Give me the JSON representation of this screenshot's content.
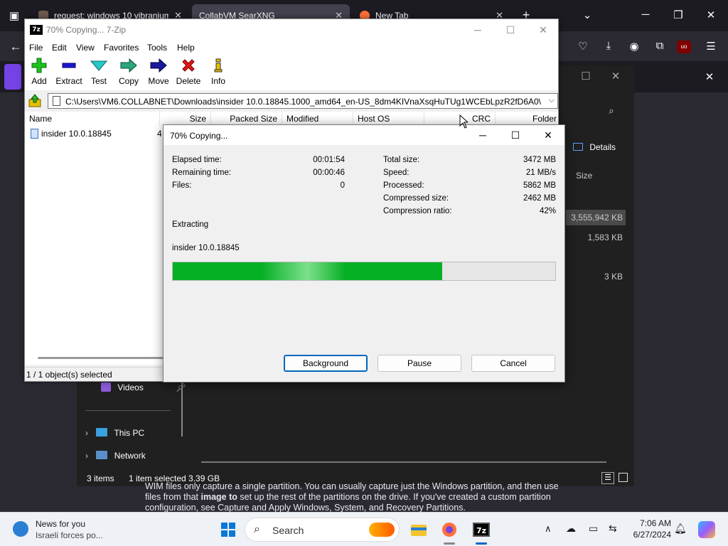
{
  "browser": {
    "tabs": [
      {
        "title": "request: windows 10 vibranium"
      },
      {
        "title": "CollabVM SearXNG"
      },
      {
        "title": "New Tab"
      }
    ],
    "page_text_line1": "WIM files only capture a single partition. You can usually capture just the Windows partition, and then use",
    "page_text_line2_a": "files from that ",
    "page_text_line2_bold": "image to",
    "page_text_line2_b": " set up the rest of the partitions on the drive. If you've created a custom partition",
    "page_text_line3": "configuration, see Capture and Apply Windows, System, and Recovery Partitions."
  },
  "explorer": {
    "details_label": "Details",
    "size_header": "Size",
    "sizes": [
      "3,555,942 KB",
      "1,583 KB",
      "3 KB"
    ],
    "nav_items": [
      {
        "label": "Videos"
      },
      {
        "label": "This PC"
      },
      {
        "label": "Network"
      }
    ],
    "status": {
      "items": "3 items",
      "selected": "1 item selected  3.39 GB"
    }
  },
  "zip": {
    "window_title": "70% Copying... 7-Zip",
    "menu": [
      "File",
      "Edit",
      "View",
      "Favorites",
      "Tools",
      "Help"
    ],
    "toolbar": [
      {
        "label": "Add",
        "icon": "add-icon"
      },
      {
        "label": "Extract",
        "icon": "extract-icon"
      },
      {
        "label": "Test",
        "icon": "test-icon"
      },
      {
        "label": "Copy",
        "icon": "copy-icon"
      },
      {
        "label": "Move",
        "icon": "move-icon"
      },
      {
        "label": "Delete",
        "icon": "delete-icon"
      },
      {
        "label": "Info",
        "icon": "info-icon"
      }
    ],
    "path": "C:\\Users\\VM6.COLLABNET\\Downloads\\insider 10.0.18845.1000_amd64_en-US_8dm4KIVnaXsqHuTUg1WCEbLpzR2fD6A0\\",
    "columns": [
      "Name",
      "Size",
      "Packed Size",
      "Modified",
      "Host OS",
      "CRC",
      "Folder"
    ],
    "row_name": "insider 10.0.18845",
    "row_size": "4",
    "status": "1 / 1 object(s) selected"
  },
  "dialog": {
    "title": "70% Copying...",
    "left": [
      {
        "label": "Elapsed time:",
        "value": "00:01:54"
      },
      {
        "label": "Remaining time:",
        "value": "00:00:46"
      },
      {
        "label": "Files:",
        "value": "0"
      }
    ],
    "right": [
      {
        "label": "Total size:",
        "value": "3472 MB"
      },
      {
        "label": "Speed:",
        "value": "21 MB/s"
      },
      {
        "label": "Processed:",
        "value": "5862 MB"
      },
      {
        "label": "Compressed size:",
        "value": "2462 MB"
      },
      {
        "label": "Compression ratio:",
        "value": "42%"
      }
    ],
    "operation": "Extracting",
    "current_file": "insider 10.0.18845",
    "progress_fraction": 0.705,
    "buttons": {
      "background": "Background",
      "pause": "Pause",
      "cancel": "Cancel"
    }
  },
  "taskbar": {
    "news_title": "News for you",
    "news_sub": "Israeli forces po...",
    "search_label": "Search",
    "time": "7:06 AM",
    "date": "6/27/2024"
  },
  "colors": {
    "progress_green": "#06b025",
    "accent_blue": "#0067c0",
    "firefox_dark": "#1c1b22"
  }
}
